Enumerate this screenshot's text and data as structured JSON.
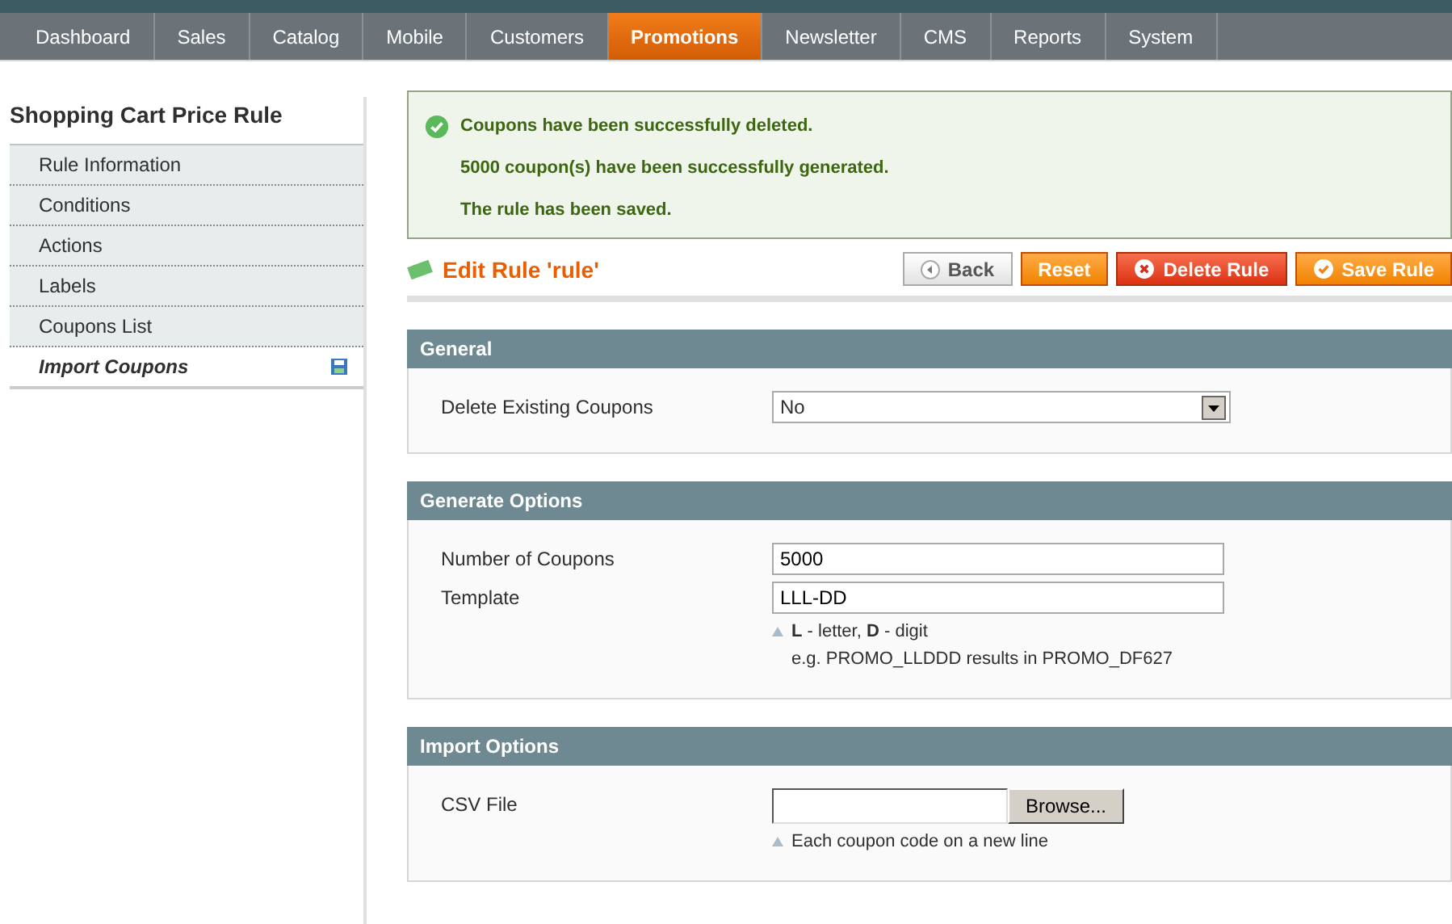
{
  "nav": [
    {
      "label": "Dashboard",
      "selected": false
    },
    {
      "label": "Sales",
      "selected": false
    },
    {
      "label": "Catalog",
      "selected": false
    },
    {
      "label": "Mobile",
      "selected": false
    },
    {
      "label": "Customers",
      "selected": false
    },
    {
      "label": "Promotions",
      "selected": true
    },
    {
      "label": "Newsletter",
      "selected": false
    },
    {
      "label": "CMS",
      "selected": false
    },
    {
      "label": "Reports",
      "selected": false
    },
    {
      "label": "System",
      "selected": false
    }
  ],
  "sidebar": {
    "title": "Shopping Cart Price Rule",
    "items": [
      {
        "label": "Rule Information",
        "selected": false
      },
      {
        "label": "Conditions",
        "selected": false
      },
      {
        "label": "Actions",
        "selected": false
      },
      {
        "label": "Labels",
        "selected": false
      },
      {
        "label": "Coupons List",
        "selected": false
      },
      {
        "label": "Import Coupons",
        "selected": true
      }
    ]
  },
  "messages": [
    "Coupons have been successfully deleted.",
    "5000 coupon(s) have been successfully generated.",
    "The rule has been saved."
  ],
  "page_title": "Edit Rule 'rule'",
  "buttons": [
    {
      "label": "Back",
      "kind": "back"
    },
    {
      "label": "Reset",
      "kind": "reset"
    },
    {
      "label": "Delete Rule",
      "kind": "delete"
    },
    {
      "label": "Save Rule",
      "kind": "save"
    }
  ],
  "sections": [
    {
      "title": "General",
      "fields": [
        {
          "kind": "select",
          "label": "Delete Existing Coupons",
          "value": "No"
        }
      ]
    },
    {
      "title": "Generate Options",
      "fields": [
        {
          "kind": "text",
          "label": "Number of Coupons",
          "value": "5000"
        },
        {
          "kind": "text",
          "label": "Template",
          "value": "LLL-DD",
          "notes": [
            "**L** - letter, **D** - digit",
            "e.g. PROMO_LLDDD results in PROMO_DF627"
          ]
        }
      ]
    },
    {
      "title": "Import Options",
      "fields": [
        {
          "kind": "file",
          "label": "CSV File",
          "button": "Browse...",
          "notes": [
            "Each coupon code on a new line"
          ]
        }
      ]
    }
  ]
}
